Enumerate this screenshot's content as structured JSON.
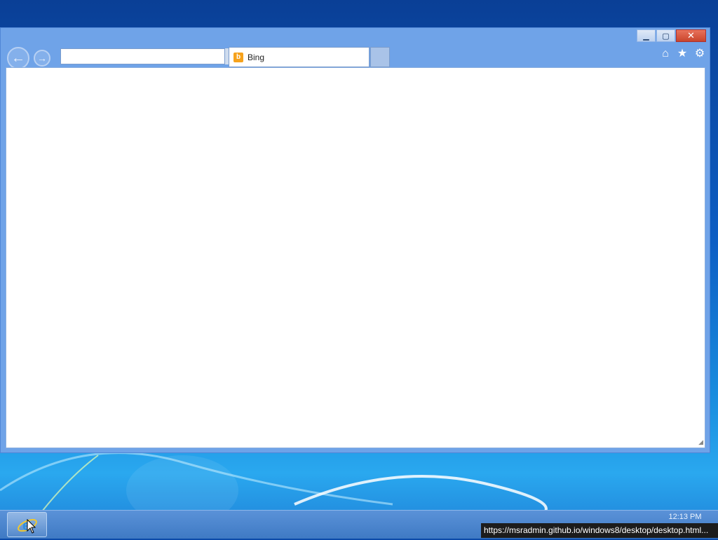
{
  "browser": {
    "address_value": "",
    "tab_title": "Bing",
    "controls": {
      "minimize": "▁",
      "maximize": "▢",
      "close": "✕"
    },
    "nav": {
      "back": "←",
      "forward": "→"
    },
    "toolbar_icons": [
      "home-icon",
      "star-icon",
      "gear-icon"
    ]
  },
  "taskbar": {
    "clock": "12:13 PM",
    "pinned": [
      "internet-explorer-icon"
    ]
  },
  "status_bar": {
    "url": "https://msradmin.github.io/windows8/desktop/desktop.html..."
  },
  "colors": {
    "window_frame": "#6fa3e8",
    "close_button": "#c9452c",
    "bing_accent": "#f6a21c"
  }
}
